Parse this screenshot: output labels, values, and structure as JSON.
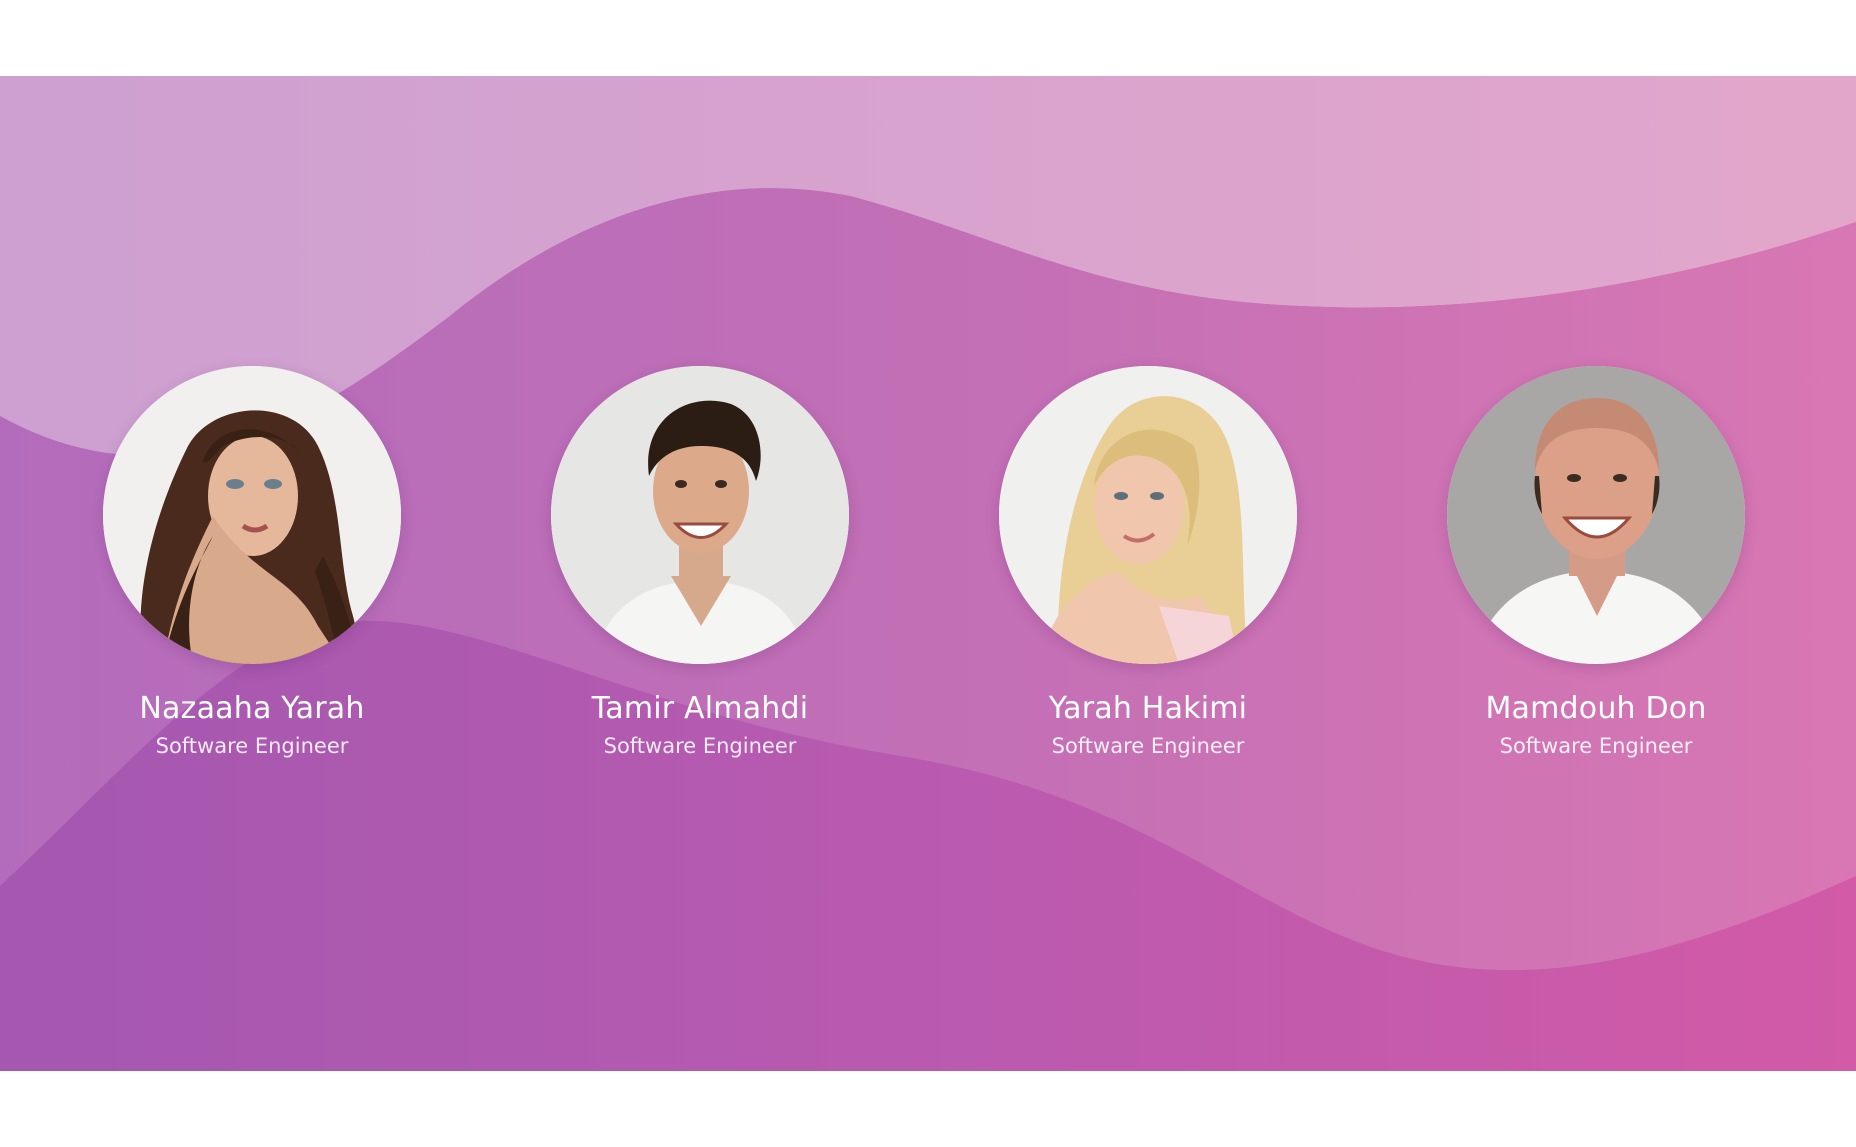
{
  "theme": {
    "gradient_left": "#a65ab1",
    "gradient_right": "#d35ba9",
    "wave_light": "#dca7cf",
    "text_color": "#ffffff"
  },
  "team": [
    {
      "name": "Nazaaha Yarah",
      "role": "Software Engineer",
      "photo": "woman-brunette-portrait"
    },
    {
      "name": "Tamir Almahdi",
      "role": "Software Engineer",
      "photo": "man-smiling-portrait"
    },
    {
      "name": "Yarah Hakimi",
      "role": "Software Engineer",
      "photo": "woman-blonde-portrait"
    },
    {
      "name": "Mamdouh Don",
      "role": "Software Engineer",
      "photo": "man-bald-portrait"
    }
  ]
}
